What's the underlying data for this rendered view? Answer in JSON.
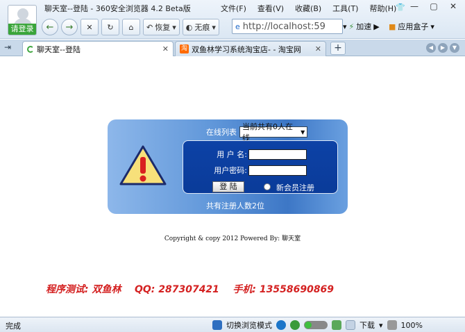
{
  "window": {
    "title": "聊天室--登陆 - 360安全浏览器 4.2 Beta版",
    "login_badge": "请登录",
    "menu": [
      "文件(F)",
      "查看(V)",
      "收藏(B)",
      "工具(T)",
      "帮助(H)"
    ],
    "controls": [
      "—",
      "▢",
      "✕"
    ]
  },
  "toolbar": {
    "restore_label": "恢复",
    "incognito_label": "无痕",
    "address": "http://localhost:59",
    "boost_label": "加速",
    "app_box_label": "应用盒子"
  },
  "tabs": [
    {
      "label": "聊天室--登陆",
      "active": true
    },
    {
      "label": "双鱼林学习系统淘宝店- - 淘宝网",
      "active": false
    }
  ],
  "login": {
    "online_label": "在线列表",
    "online_selected": "当前共有0人在线",
    "username_label": "用 户 名:",
    "password_label": "用户密码:",
    "username_value": "",
    "password_value": "",
    "submit_label": "登 陆",
    "register_label": "新会员注册",
    "register_count": "共有注册人数2位"
  },
  "footer": {
    "copyright": "Copyright & copy 2012    Powered By: 聊天室",
    "promo": "程序测试: 双鱼林    QQ: 287307421    手机: 13558690869"
  },
  "statusbar": {
    "status": "完成",
    "mode_switch": "切换浏览模式",
    "download": "下载",
    "zoom": "100%"
  },
  "colors": {
    "panel_blue": "#3d77c6",
    "inner_blue": "#0d42a6",
    "promo_red": "#d42121",
    "login_green": "#3aa53a"
  }
}
